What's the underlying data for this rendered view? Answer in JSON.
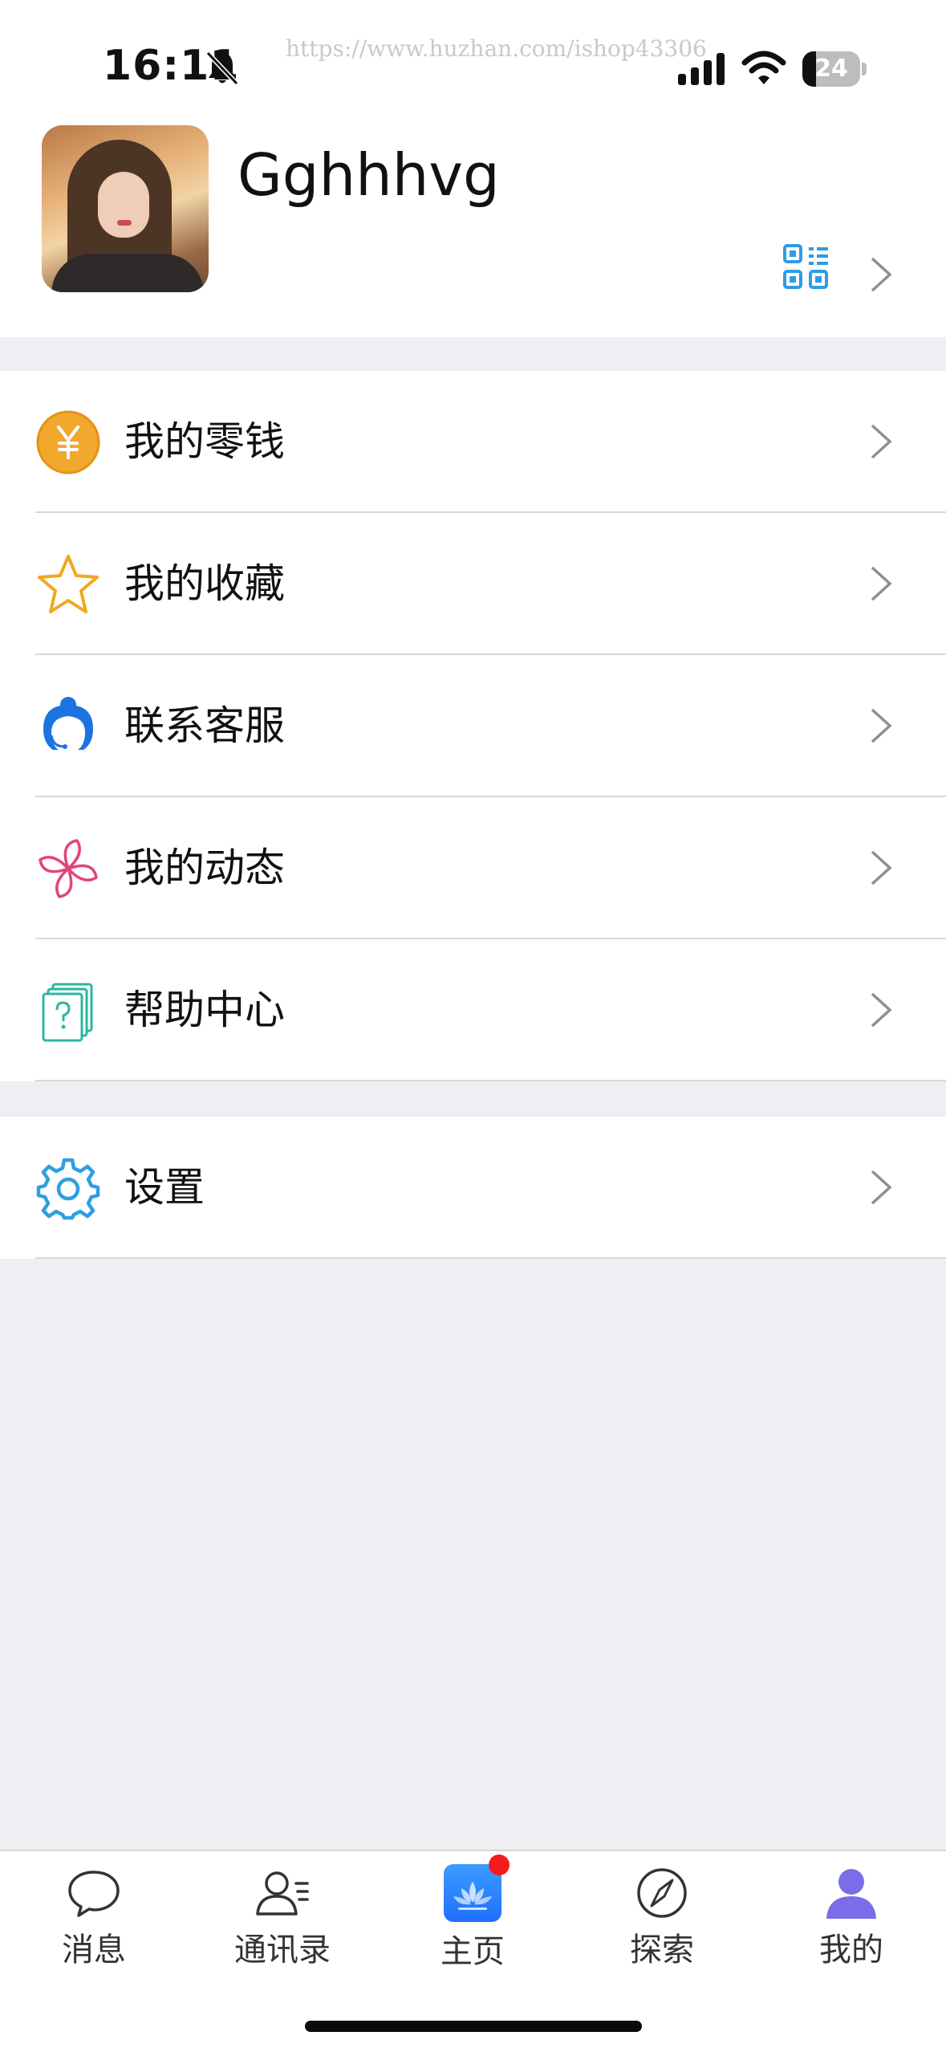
{
  "status_bar": {
    "time": "16:11",
    "battery_percent": 24,
    "battery_label": "24",
    "watermark": "https://www.huzhan.com/ishop43306",
    "icons": [
      "bell-off-icon",
      "signal-icon",
      "wifi-icon",
      "battery-icon"
    ]
  },
  "profile": {
    "username": "Gghhhvg",
    "qr_icon": "qr-code-icon",
    "qr_color": "#2f9be6"
  },
  "menu": {
    "group1": [
      {
        "label": "我的零钱",
        "icon": "wallet-yuan-icon",
        "color": "#f2a72d"
      },
      {
        "label": "我的收藏",
        "icon": "star-icon",
        "color": "#f0a81f"
      },
      {
        "label": "联系客服",
        "icon": "customer-service-icon",
        "color": "#1c73e0"
      },
      {
        "label": "我的动态",
        "icon": "pinwheel-icon",
        "color": "#e0457b"
      },
      {
        "label": "帮助中心",
        "icon": "help-icon",
        "color": "#2bb6a0"
      }
    ],
    "group2": [
      {
        "label": "设置",
        "icon": "settings-gear-icon",
        "color": "#2d9fe3"
      }
    ]
  },
  "tab_bar": {
    "tabs": [
      {
        "label": "消息",
        "icon": "chat-bubble-icon"
      },
      {
        "label": "通讯录",
        "icon": "contacts-icon"
      },
      {
        "label": "主页",
        "icon": "home-lotus-icon",
        "badge": true
      },
      {
        "label": "探索",
        "icon": "compass-icon"
      },
      {
        "label": "我的",
        "icon": "profile-person-icon",
        "active": true
      }
    ],
    "active_color": "#7b6ce8",
    "badge_color": "#f51b1b"
  }
}
